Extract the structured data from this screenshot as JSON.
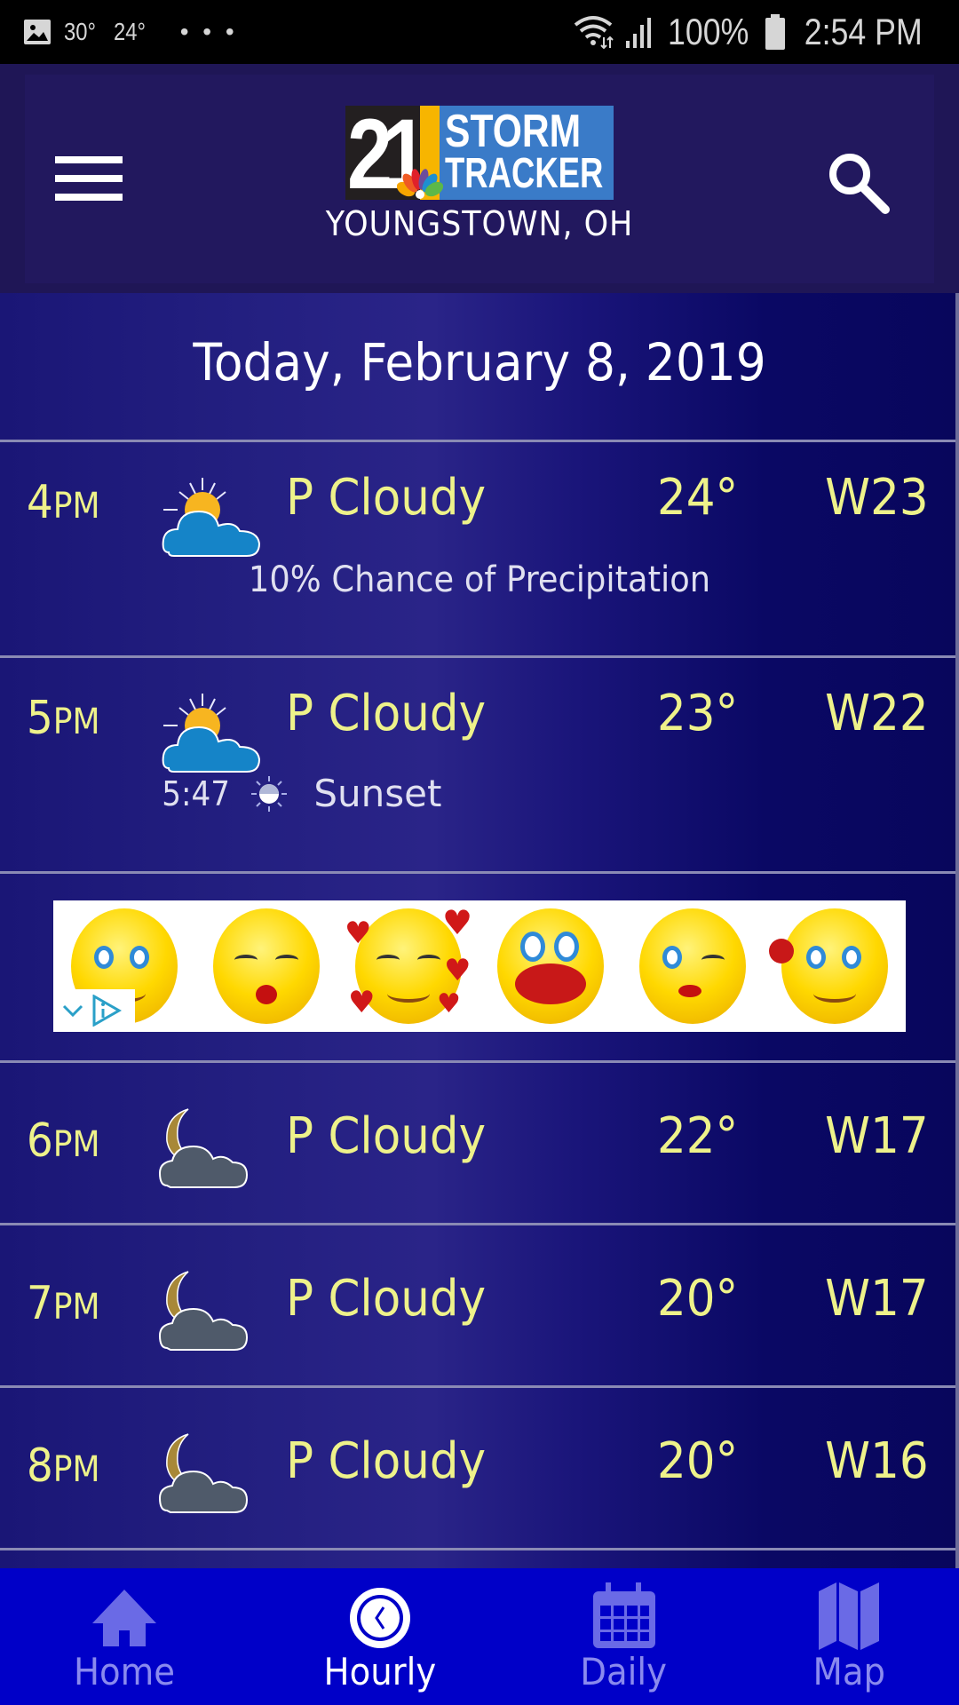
{
  "status_bar": {
    "temp_high": "30°",
    "temp_low": "24°",
    "more": "• • •",
    "battery": "100%",
    "time": "2:54 PM",
    "icons": [
      "image-icon",
      "wifi-icon",
      "signal-icon",
      "battery-icon"
    ]
  },
  "header": {
    "logo_number": "21",
    "logo_line1": "STORM",
    "logo_line2": "TRACKER",
    "location": "YOUNGSTOWN, OH",
    "menu_icon": "hamburger-menu-icon",
    "search_icon": "search-icon"
  },
  "date_title": "Today, February 8, 2019",
  "hours": [
    {
      "hour": "4",
      "ampm": "PM",
      "icon": "partly-cloudy-day-icon",
      "condition": "P Cloudy",
      "temp": "24°",
      "wind": "W23",
      "precip": "10% Chance of Precipitation"
    },
    {
      "hour": "5",
      "ampm": "PM",
      "icon": "partly-cloudy-day-icon",
      "condition": "P Cloudy",
      "temp": "23°",
      "wind": "W22",
      "sunset_time": "5:47",
      "sunset_label": "Sunset"
    },
    {
      "hour": "6",
      "ampm": "PM",
      "icon": "partly-cloudy-night-icon",
      "condition": "P Cloudy",
      "temp": "22°",
      "wind": "W17"
    },
    {
      "hour": "7",
      "ampm": "PM",
      "icon": "partly-cloudy-night-icon",
      "condition": "P Cloudy",
      "temp": "20°",
      "wind": "W17"
    },
    {
      "hour": "8",
      "ampm": "PM",
      "icon": "partly-cloudy-night-icon",
      "condition": "P Cloudy",
      "temp": "20°",
      "wind": "W16"
    }
  ],
  "ad": {
    "description": "Valentine emoji banner advertisement",
    "badge_icons": [
      "chevron-down-icon",
      "ad-choices-icon"
    ]
  },
  "bottom_nav": {
    "items": [
      {
        "label": "Home",
        "icon": "home-icon",
        "active": false
      },
      {
        "label": "Hourly",
        "icon": "clock-icon",
        "active": true
      },
      {
        "label": "Daily",
        "icon": "calendar-icon",
        "active": false
      },
      {
        "label": "Map",
        "icon": "map-icon",
        "active": false
      }
    ]
  },
  "colors": {
    "accent_yellow": "#eef28a",
    "nav_background": "#0000c8",
    "nav_inactive": "#8a8aee",
    "header_background": "#22185e"
  }
}
